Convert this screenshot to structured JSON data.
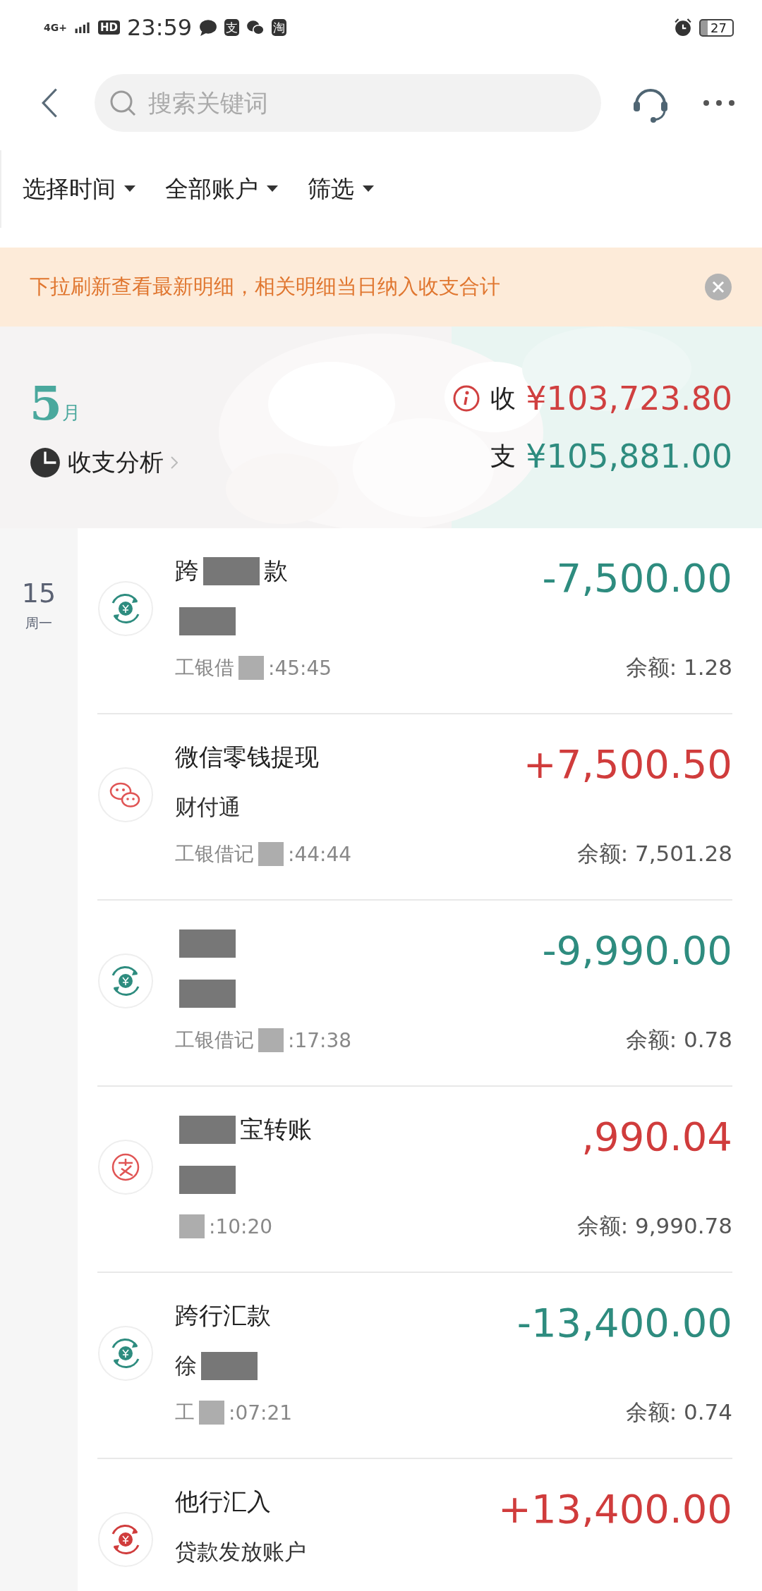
{
  "status_bar": {
    "network": "4G+",
    "hd": "HD",
    "time": "23:59",
    "notifications": [
      {
        "kind": "bubble"
      },
      {
        "kind": "glyph",
        "text": "支"
      },
      {
        "kind": "wechat"
      },
      {
        "kind": "glyph",
        "text": "淘"
      }
    ],
    "battery": "27"
  },
  "search": {
    "placeholder": "搜索关键词"
  },
  "filters": [
    {
      "label": "选择时间"
    },
    {
      "label": "全部账户"
    },
    {
      "label": "筛选"
    }
  ],
  "notice": {
    "text": "下拉刷新查看最新明细，相关明细当日纳入收支合计"
  },
  "summary": {
    "month": "5",
    "month_unit": "月",
    "analysis_link": "收支分析",
    "income_label": "收",
    "income": "¥103,723.80",
    "expense_label": "支",
    "expense": "¥105,881.00"
  },
  "day": {
    "date": "15",
    "weekday": "周一"
  },
  "transactions": [
    {
      "kind": "transfer",
      "color": "#2e8c7f",
      "title": [
        {
          "kind": "text",
          "text": "跨"
        },
        {
          "kind": "mask"
        },
        {
          "kind": "text",
          "text": "款"
        }
      ],
      "subtitle": [
        {
          "kind": "mask"
        }
      ],
      "meta": [
        {
          "kind": "text",
          "text": "工银借"
        },
        {
          "kind": "mask"
        },
        {
          "kind": "text",
          "text": ":45:45"
        }
      ],
      "amount": "-7,500.00",
      "balance": "余额: 1.28"
    },
    {
      "kind": "wechat",
      "color": "#d03c3c",
      "title": [
        {
          "kind": "text",
          "text": "微信零钱提现"
        }
      ],
      "subtitle": [
        {
          "kind": "text",
          "text": "财付通"
        }
      ],
      "meta": [
        {
          "kind": "text",
          "text": "工银借记"
        },
        {
          "kind": "mask"
        },
        {
          "kind": "text",
          "text": ":44:44"
        }
      ],
      "amount": "+7,500.50",
      "balance": "余额: 7,501.28"
    },
    {
      "kind": "transfer",
      "color": "#2e8c7f",
      "title": [
        {
          "kind": "mask"
        }
      ],
      "subtitle": [
        {
          "kind": "mask"
        }
      ],
      "meta": [
        {
          "kind": "text",
          "text": "工银借记"
        },
        {
          "kind": "mask"
        },
        {
          "kind": "text",
          "text": ":17:38"
        }
      ],
      "amount": "-9,990.00",
      "balance": "余额: 0.78"
    },
    {
      "kind": "seal",
      "color": "#d03c3c",
      "title": [
        {
          "kind": "mask"
        },
        {
          "kind": "text",
          "text": "宝转账"
        }
      ],
      "subtitle": [
        {
          "kind": "mask"
        }
      ],
      "meta": [
        {
          "kind": "mask"
        },
        {
          "kind": "text",
          "text": ":10:20"
        }
      ],
      "amount": ",990.04",
      "balance": "余额: 9,990.78"
    },
    {
      "kind": "transfer",
      "color": "#2e8c7f",
      "title": [
        {
          "kind": "text",
          "text": "跨行汇款"
        }
      ],
      "subtitle": [
        {
          "kind": "text",
          "text": "徐"
        },
        {
          "kind": "mask"
        }
      ],
      "meta": [
        {
          "kind": "text",
          "text": "工"
        },
        {
          "kind": "mask"
        },
        {
          "kind": "text",
          "text": ":07:21"
        }
      ],
      "amount": "-13,400.00",
      "balance": "余额: 0.74"
    },
    {
      "kind": "transfer",
      "color": "#d03c3c",
      "title": [
        {
          "kind": "text",
          "text": "他行汇入"
        }
      ],
      "subtitle": [
        {
          "kind": "text",
          "text": "贷款发放账户"
        }
      ],
      "amount": "+13,400.00"
    }
  ]
}
